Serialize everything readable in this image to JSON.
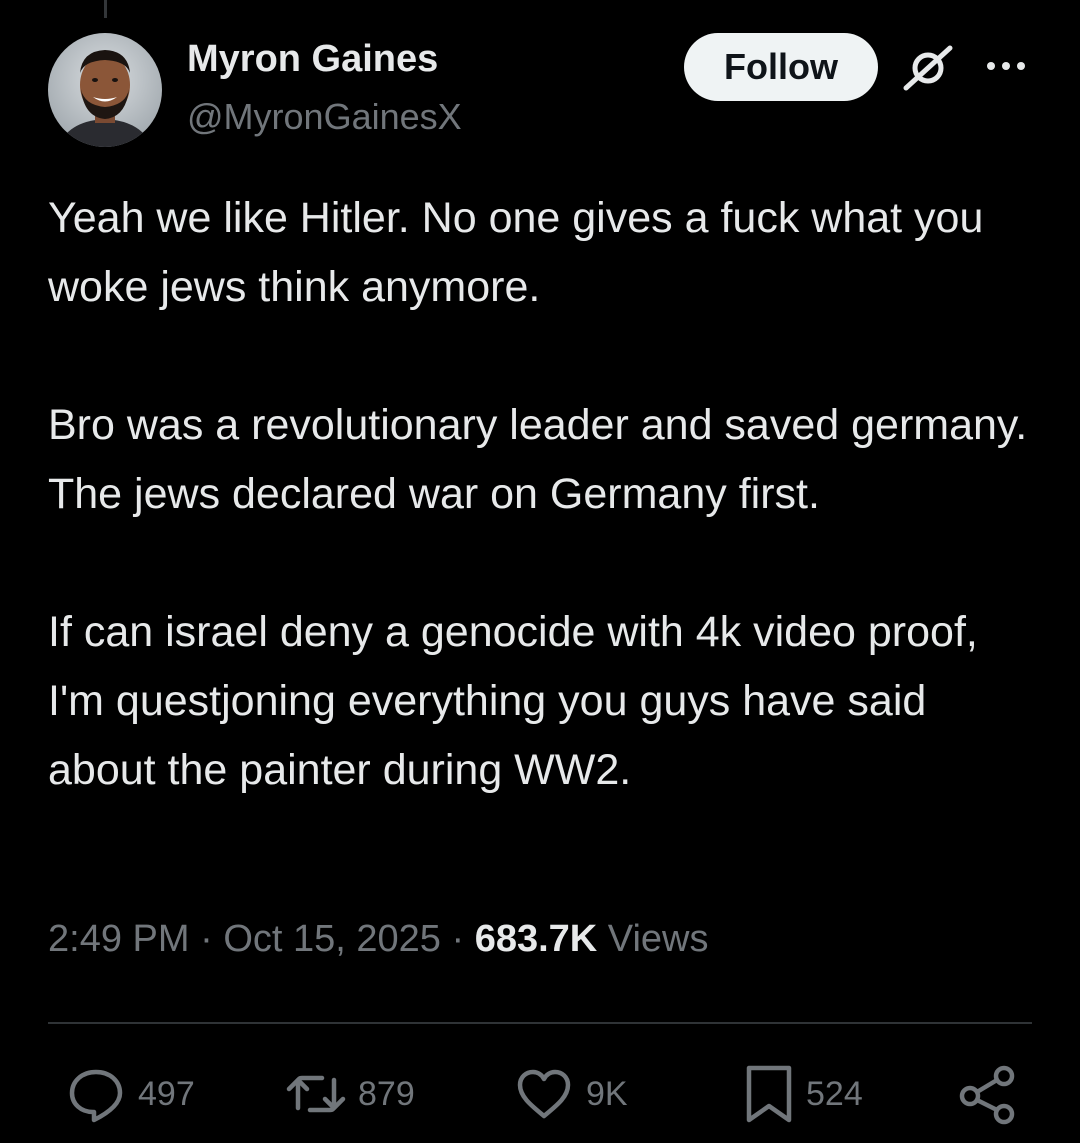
{
  "tweet": {
    "author": {
      "name": "Myron Gaines",
      "handle": "@MyronGainesX"
    },
    "follow_label": "Follow",
    "paragraphs": [
      "Yeah we like Hitler. No one gives a fuck what you woke jews think anymore.",
      "Bro was a revolutionary leader and saved germany. The jews declared war on Germany first.",
      "If can israel deny a genocide with 4k video proof, I'm questjoning everything you guys have said about the painter during WW2."
    ],
    "meta": {
      "time": "2:49 PM",
      "date": "Oct 15, 2025",
      "separator": "·",
      "views": "683.7K",
      "views_label": "Views"
    },
    "actions": {
      "replies": "497",
      "reposts": "879",
      "likes": "9K",
      "bookmarks": "524"
    }
  },
  "icons": {
    "grok": "grok-icon",
    "more": "more-icon",
    "reply": "reply-icon",
    "repost": "repost-icon",
    "like": "heart-icon",
    "bookmark": "bookmark-icon",
    "share": "share-icon"
  },
  "colors": {
    "background": "#000000",
    "primary_text": "#e7e9ea",
    "secondary_text": "#71767b",
    "follow_button_bg": "#eff3f4",
    "follow_button_text": "#0f1419",
    "divider": "#2f3336"
  }
}
